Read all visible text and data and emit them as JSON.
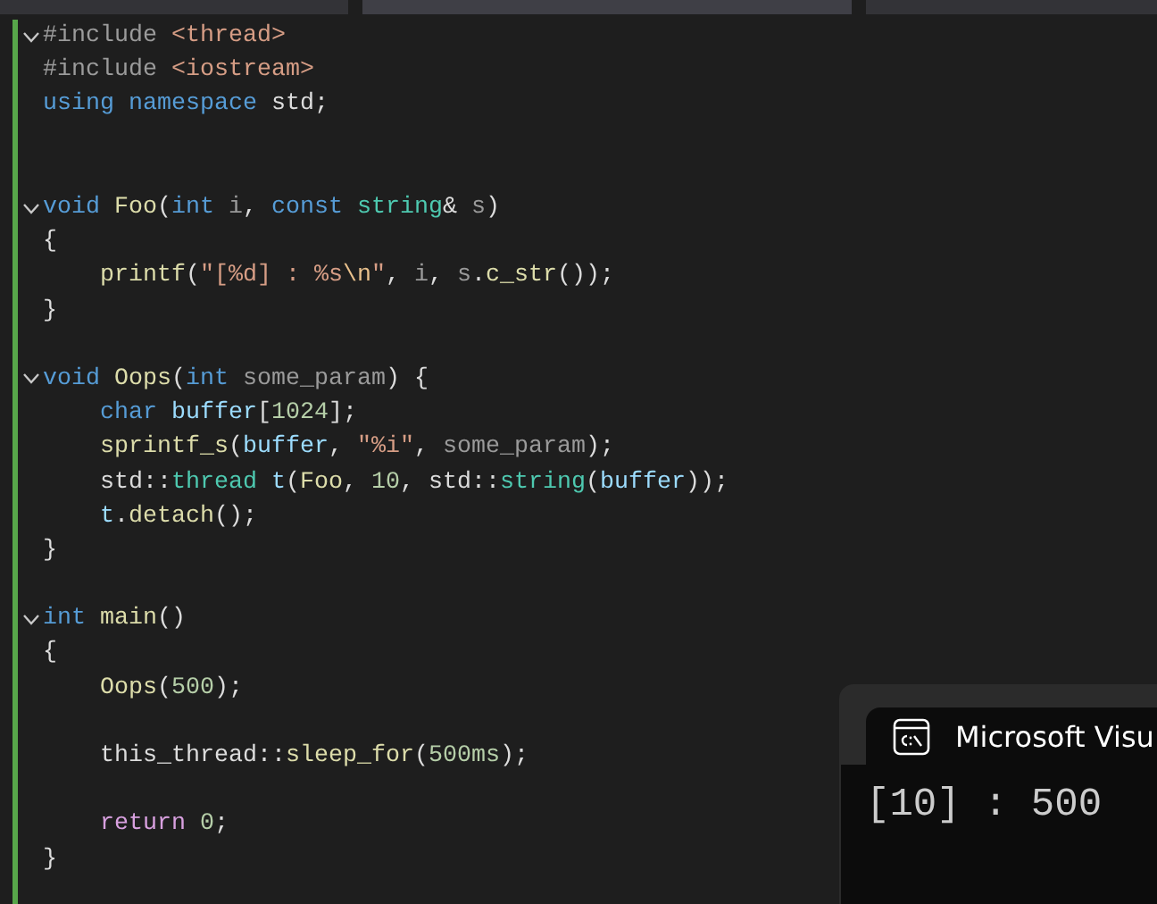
{
  "editor_tabs": [
    {
      "selected": false
    },
    {
      "selected": true
    },
    {
      "selected": false
    }
  ],
  "code_lines": [
    {
      "kind": "fold",
      "tokens": [
        {
          "kind": "pp",
          "text": "#include "
        },
        {
          "kind": "str",
          "text": "<thread>"
        }
      ]
    },
    {
      "kind": "line",
      "tokens": [
        {
          "kind": "pp",
          "text": "#include "
        },
        {
          "kind": "str",
          "text": "<iostream>"
        }
      ]
    },
    {
      "kind": "line",
      "tokens": [
        {
          "kind": "kw",
          "text": "using "
        },
        {
          "kind": "kw",
          "text": "namespace "
        },
        {
          "kind": "plain",
          "text": "std;"
        }
      ]
    },
    {
      "kind": "line"
    },
    {
      "kind": "line"
    },
    {
      "kind": "fold",
      "tokens": [
        {
          "kind": "kw",
          "text": "void "
        },
        {
          "kind": "fn",
          "text": "Foo"
        },
        {
          "kind": "plain",
          "text": "("
        },
        {
          "kind": "kw",
          "text": "int "
        },
        {
          "kind": "param",
          "text": "i"
        },
        {
          "kind": "plain",
          "text": ", "
        },
        {
          "kind": "kw",
          "text": "const "
        },
        {
          "kind": "type",
          "text": "string"
        },
        {
          "kind": "plain",
          "text": "& "
        },
        {
          "kind": "param",
          "text": "s"
        },
        {
          "kind": "plain",
          "text": ")"
        }
      ]
    },
    {
      "kind": "line",
      "tokens": [
        {
          "kind": "plain",
          "text": "{"
        }
      ]
    },
    {
      "kind": "line",
      "tokens": [
        {
          "kind": "fn",
          "text": "    printf"
        },
        {
          "kind": "plain",
          "text": "("
        },
        {
          "kind": "str",
          "text": "\"[%d] : %s"
        },
        {
          "kind": "esc",
          "text": "\\n"
        },
        {
          "kind": "str",
          "text": "\""
        },
        {
          "kind": "plain",
          "text": ", "
        },
        {
          "kind": "param",
          "text": "i"
        },
        {
          "kind": "plain",
          "text": ", "
        },
        {
          "kind": "param",
          "text": "s"
        },
        {
          "kind": "plain",
          "text": "."
        },
        {
          "kind": "fn",
          "text": "c_str"
        },
        {
          "kind": "plain",
          "text": "());"
        }
      ]
    },
    {
      "kind": "line",
      "tokens": [
        {
          "kind": "plain",
          "text": "}"
        }
      ]
    },
    {
      "kind": "line"
    },
    {
      "kind": "fold",
      "tokens": [
        {
          "kind": "kw",
          "text": "void "
        },
        {
          "kind": "fn",
          "text": "Oops"
        },
        {
          "kind": "plain",
          "text": "("
        },
        {
          "kind": "kw",
          "text": "int "
        },
        {
          "kind": "param",
          "text": "some_param"
        },
        {
          "kind": "plain",
          "text": ") {"
        }
      ]
    },
    {
      "kind": "line",
      "tokens": [
        {
          "kind": "kw",
          "text": "    char "
        },
        {
          "kind": "var",
          "text": "buffer"
        },
        {
          "kind": "plain",
          "text": "["
        },
        {
          "kind": "num",
          "text": "1024"
        },
        {
          "kind": "plain",
          "text": "];"
        }
      ]
    },
    {
      "kind": "line",
      "tokens": [
        {
          "kind": "fn",
          "text": "    sprintf_s"
        },
        {
          "kind": "plain",
          "text": "("
        },
        {
          "kind": "var",
          "text": "buffer"
        },
        {
          "kind": "plain",
          "text": ", "
        },
        {
          "kind": "str",
          "text": "\"%i\""
        },
        {
          "kind": "plain",
          "text": ", "
        },
        {
          "kind": "param",
          "text": "some_param"
        },
        {
          "kind": "plain",
          "text": ");"
        }
      ]
    },
    {
      "kind": "line",
      "tokens": [
        {
          "kind": "plain",
          "text": "    std::"
        },
        {
          "kind": "type",
          "text": "thread "
        },
        {
          "kind": "var",
          "text": "t"
        },
        {
          "kind": "plain",
          "text": "("
        },
        {
          "kind": "fn",
          "text": "Foo"
        },
        {
          "kind": "plain",
          "text": ", "
        },
        {
          "kind": "num",
          "text": "10"
        },
        {
          "kind": "plain",
          "text": ", std::"
        },
        {
          "kind": "type",
          "text": "string"
        },
        {
          "kind": "plain",
          "text": "("
        },
        {
          "kind": "var",
          "text": "buffer"
        },
        {
          "kind": "plain",
          "text": "));"
        }
      ]
    },
    {
      "kind": "line",
      "tokens": [
        {
          "kind": "var",
          "text": "    t"
        },
        {
          "kind": "plain",
          "text": "."
        },
        {
          "kind": "fn",
          "text": "detach"
        },
        {
          "kind": "plain",
          "text": "();"
        }
      ]
    },
    {
      "kind": "line",
      "tokens": [
        {
          "kind": "plain",
          "text": "}"
        }
      ]
    },
    {
      "kind": "line"
    },
    {
      "kind": "fold",
      "tokens": [
        {
          "kind": "kw",
          "text": "int "
        },
        {
          "kind": "fn",
          "text": "main"
        },
        {
          "kind": "plain",
          "text": "()"
        }
      ]
    },
    {
      "kind": "line",
      "tokens": [
        {
          "kind": "plain",
          "text": "{"
        }
      ]
    },
    {
      "kind": "line",
      "tokens": [
        {
          "kind": "fn",
          "text": "    Oops"
        },
        {
          "kind": "plain",
          "text": "("
        },
        {
          "kind": "num",
          "text": "500"
        },
        {
          "kind": "plain",
          "text": ");"
        }
      ]
    },
    {
      "kind": "line"
    },
    {
      "kind": "line",
      "tokens": [
        {
          "kind": "plain",
          "text": "    this_thread::"
        },
        {
          "kind": "fn",
          "text": "sleep_for"
        },
        {
          "kind": "plain",
          "text": "("
        },
        {
          "kind": "num",
          "text": "500ms"
        },
        {
          "kind": "plain",
          "text": ");"
        }
      ]
    },
    {
      "kind": "line"
    },
    {
      "kind": "line",
      "tokens": [
        {
          "kind": "ctrl",
          "text": "    return "
        },
        {
          "kind": "num",
          "text": "0"
        },
        {
          "kind": "plain",
          "text": ";"
        }
      ]
    },
    {
      "kind": "line",
      "tokens": [
        {
          "kind": "plain",
          "text": "}"
        }
      ]
    }
  ],
  "console": {
    "title": "Microsoft Visu",
    "output": "[10] : 500"
  }
}
